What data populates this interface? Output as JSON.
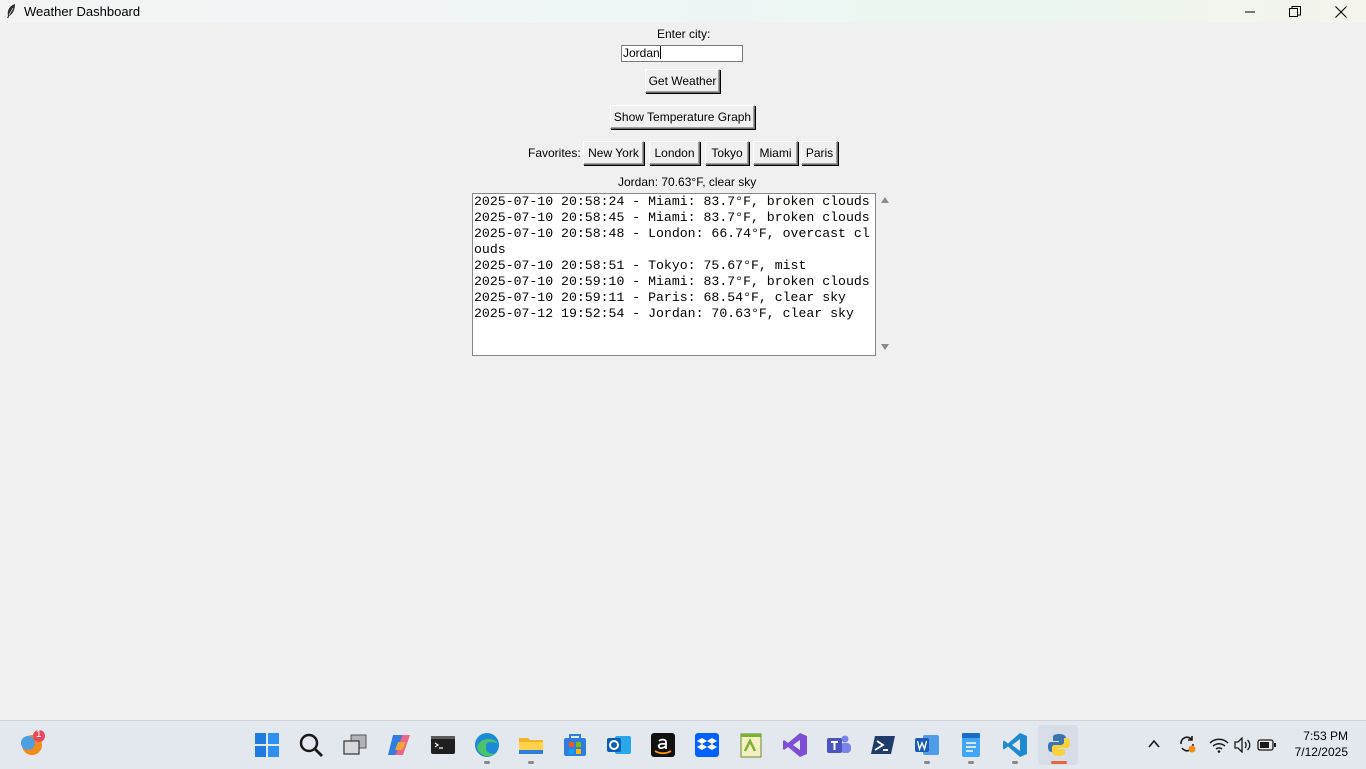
{
  "window": {
    "title": "Weather Dashboard"
  },
  "form": {
    "city_label": "Enter city:",
    "city_value": "Jordan",
    "get_weather_label": "Get Weather",
    "graph_label": "Show Temperature Graph",
    "favorites_label": "Favorites:",
    "favorites": [
      "New York",
      "London",
      "Tokyo",
      "Miami",
      "Paris"
    ]
  },
  "result": {
    "text": "Jordan: 70.63°F, clear sky"
  },
  "history": [
    "2025-07-10 20:58:24 - Miami: 83.7°F, broken clouds",
    "2025-07-10 20:58:45 - Miami: 83.7°F, broken clouds",
    "2025-07-10 20:58:48 - London: 66.74°F, overcast cl",
    "ouds",
    "2025-07-10 20:58:51 - Tokyo: 75.67°F, mist",
    "2025-07-10 20:59:10 - Miami: 83.7°F, broken clouds",
    "2025-07-10 20:59:11 - Paris: 68.54°F, clear sky",
    "2025-07-12 19:52:54 - Jordan: 70.63°F, clear sky"
  ],
  "taskbar": {
    "badge": "1",
    "time": "7:53 PM",
    "date": "7/12/2025",
    "apps": [
      "start-icon",
      "search-icon",
      "task-view-icon",
      "copilot-icon",
      "terminal-icon",
      "edge-icon",
      "file-explorer-icon",
      "store-icon",
      "outlook-icon",
      "amazon-icon",
      "dropbox-icon",
      "notepad-plus-icon",
      "visual-studio-icon",
      "teams-icon",
      "powershell-icon",
      "word-icon",
      "notepad-icon",
      "vscode-icon",
      "python-icon"
    ]
  }
}
